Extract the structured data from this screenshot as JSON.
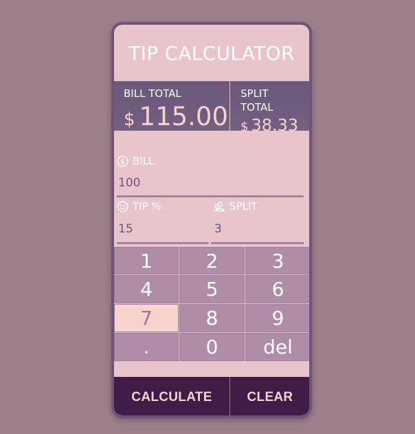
{
  "app": {
    "title": "TIP CALCULATOR"
  },
  "totals": {
    "bill_total_label": "BILL TOTAL",
    "bill_total_currency": "$",
    "bill_total_value": "115.00",
    "split_total_label": "SPLIT TOTAL",
    "split_total_currency": "$",
    "split_total_value": "38.33"
  },
  "inputs": {
    "bill": {
      "label": "BILL",
      "value": "100",
      "icon": "dollar-circle-icon"
    },
    "tip": {
      "label": "TIP %",
      "value": "15",
      "icon": "smiley-icon"
    },
    "split": {
      "label": "SPLIT",
      "value": "3",
      "icon": "people-icon"
    }
  },
  "keypad": {
    "keys": [
      "1",
      "2",
      "3",
      "4",
      "5",
      "6",
      "7",
      "8",
      "9",
      ".",
      "0",
      "del"
    ],
    "active_key": "7"
  },
  "actions": {
    "calculate_label": "CALCULATE",
    "clear_label": "CLEAR"
  },
  "colors": {
    "background": "#9c7f89",
    "card": "#e8c4cb",
    "totals_bar": "#6b587a",
    "accent_text": "#f7d2cf",
    "keypad_key": "#b08da7",
    "action_bar": "#3e1c45"
  }
}
